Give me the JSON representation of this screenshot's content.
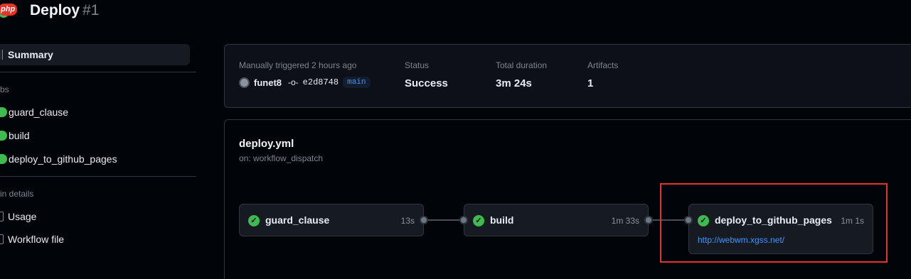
{
  "header": {
    "badge": "php",
    "title": "Deploy",
    "run_number": "#1"
  },
  "sidebar": {
    "summary_label": "Summary",
    "jobs_heading": "bs",
    "jobs": [
      {
        "label": "guard_clause"
      },
      {
        "label": "build"
      },
      {
        "label": "deploy_to_github_pages"
      }
    ],
    "run_details_heading": "in details",
    "usage_label": "Usage",
    "workflow_file_label": "Workflow file"
  },
  "summary": {
    "trigger_label": "Manually triggered 2 hours ago",
    "actor": "funet8",
    "commit_sha": "e2d8748",
    "branch": "main",
    "status_label": "Status",
    "status_value": "Success",
    "duration_label": "Total duration",
    "duration_value": "3m 24s",
    "artifacts_label": "Artifacts",
    "artifacts_value": "1"
  },
  "workflow": {
    "file": "deploy.yml",
    "trigger": "on: workflow_dispatch",
    "jobs": [
      {
        "name": "guard_clause",
        "duration": "13s"
      },
      {
        "name": "build",
        "duration": "1m 33s"
      },
      {
        "name": "deploy_to_github_pages",
        "duration": "1m 1s",
        "link": "http://webwm.xgss.net/"
      }
    ]
  },
  "colors": {
    "success": "#3fb950",
    "link": "#4493f8",
    "highlight": "#e5332a"
  }
}
